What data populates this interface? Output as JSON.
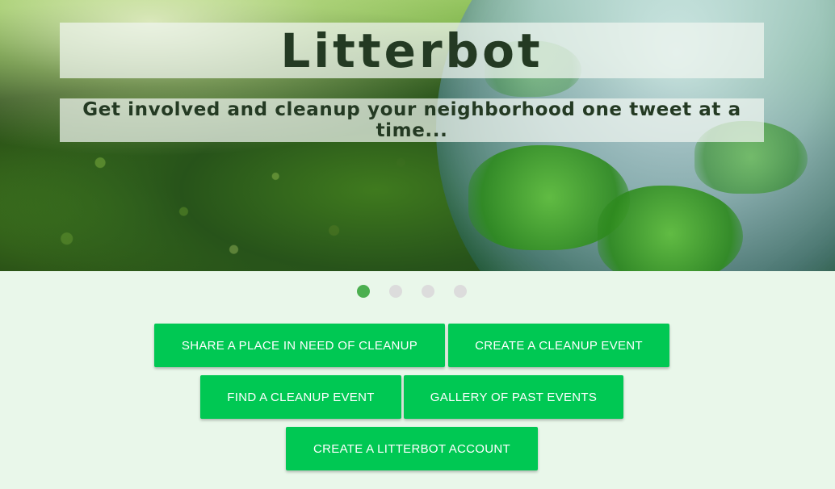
{
  "hero": {
    "title": "Litterbot",
    "subtitle": "Get involved and cleanup your neighborhood one tweet at a time..."
  },
  "carousel": {
    "slide_count": 4,
    "active_index": 0,
    "active_color": "#4caf50",
    "inactive_color": "#dcdcdc"
  },
  "actions": {
    "share_place": "SHARE A PLACE IN NEED OF CLEANUP",
    "create_event": "CREATE A CLEANUP EVENT",
    "find_event": "FIND A CLEANUP EVENT",
    "gallery": "GALLERY OF PAST EVENTS",
    "create_account": "CREATE A LITTERBOT ACCOUNT"
  },
  "colors": {
    "button": "#00c853",
    "page_background": "#e9f7ea",
    "title_text": "#243a23"
  }
}
